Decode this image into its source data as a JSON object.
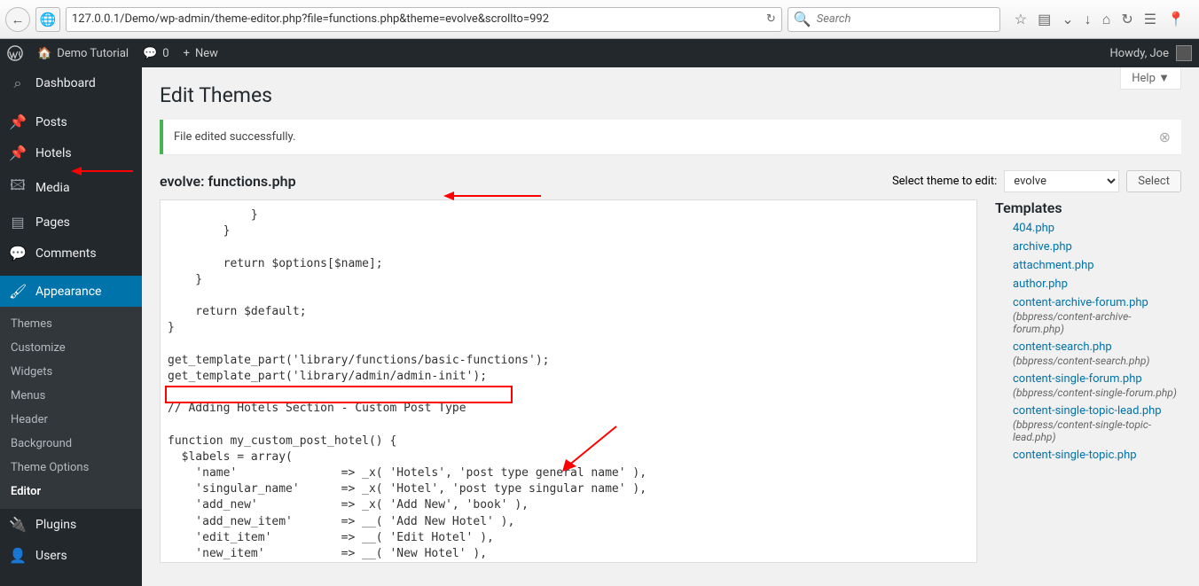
{
  "browser": {
    "url": "127.0.0.1/Demo/wp-admin/theme-editor.php?file=functions.php&theme=evolve&scrollto=992",
    "search_placeholder": "Search"
  },
  "adminbar": {
    "site_name": "Demo Tutorial",
    "comments": "0",
    "new_label": "New",
    "howdy": "Howdy, Joe"
  },
  "sidebar": {
    "items": [
      {
        "icon": "🏠",
        "label": "Dashboard"
      },
      {
        "icon": "📌",
        "label": "Posts"
      },
      {
        "icon": "📌",
        "label": "Hotels"
      },
      {
        "icon": "🖼",
        "label": "Media"
      },
      {
        "icon": "▤",
        "label": "Pages"
      },
      {
        "icon": "💬",
        "label": "Comments"
      },
      {
        "icon": "🖌",
        "label": "Appearance",
        "current": true
      },
      {
        "icon": "🔌",
        "label": "Plugins"
      },
      {
        "icon": "👤",
        "label": "Users"
      }
    ],
    "appearance_submenu": [
      "Themes",
      "Customize",
      "Widgets",
      "Menus",
      "Header",
      "Background",
      "Theme Options",
      "Editor"
    ]
  },
  "page": {
    "title": "Edit Themes",
    "help_label": "Help ▼",
    "notice": "File edited successfully.",
    "file_title": "evolve: functions.php",
    "select_label": "Select theme to edit:",
    "select_value": "evolve",
    "select_button": "Select"
  },
  "code": "            }\n        }\n\n        return $options[$name];\n    }\n\n    return $default;\n}\n\nget_template_part('library/functions/basic-functions');\nget_template_part('library/admin/admin-init');\n\n// Adding Hotels Section - Custom Post Type\n\nfunction my_custom_post_hotel() {\n  $labels = array(\n    'name'               => _x( 'Hotels', 'post type general name' ),\n    'singular_name'      => _x( 'Hotel', 'post type singular name' ),\n    'add_new'            => _x( 'Add New', 'book' ),\n    'add_new_item'       => __( 'Add New Hotel' ),\n    'edit_item'          => __( 'Edit Hotel' ),\n    'new_item'           => __( 'New Hotel' ),\n    'all_items'          => __( 'All Hotels' ),",
  "templates": {
    "heading": "Templates",
    "files": [
      {
        "name": "404.php"
      },
      {
        "name": "archive.php"
      },
      {
        "name": "attachment.php"
      },
      {
        "name": "author.php"
      },
      {
        "name": "content-archive-forum.php",
        "meta": "(bbpress/content-archive-forum.php)"
      },
      {
        "name": "content-search.php",
        "meta": "(bbpress/content-search.php)"
      },
      {
        "name": "content-single-forum.php",
        "meta": "(bbpress/content-single-forum.php)"
      },
      {
        "name": "content-single-topic-lead.php",
        "meta": "(bbpress/content-single-topic-lead.php)"
      },
      {
        "name": "content-single-topic.php"
      }
    ]
  }
}
